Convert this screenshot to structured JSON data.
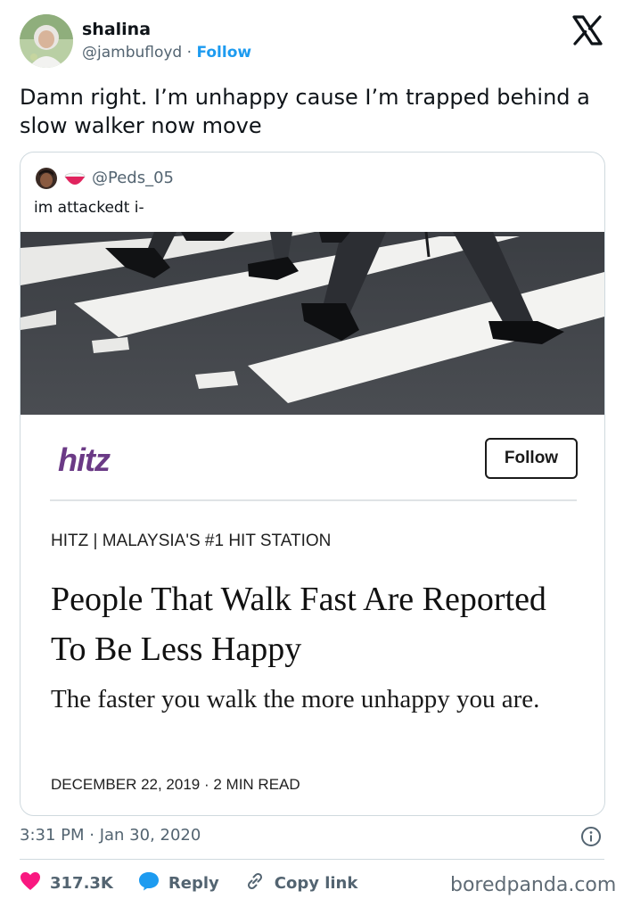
{
  "author": {
    "name": "shalina",
    "handle": "@jambufloyd",
    "separator": "·",
    "follow_label": "Follow"
  },
  "tweet": {
    "text": "Damn right. I’m unhappy cause I’m trapped behind a slow walker now move"
  },
  "quoted": {
    "handle": "@Peds_05",
    "text": "im attackedt i-",
    "article": {
      "brand": "hitz",
      "follow_label": "Follow",
      "kicker": "HITZ | MALAYSIA'S #1 HIT STATION",
      "headline": "People That Walk Fast Are Reported To Be Less Happy",
      "subheadline": "The faster you walk the more unhappy you are.",
      "dateline": "DECEMBER 22, 2019 · 2 MIN READ"
    }
  },
  "meta": {
    "timestamp": "3:31 PM · Jan 30, 2020"
  },
  "actions": {
    "likes": "317.3K",
    "reply_label": "Reply",
    "copy_label": "Copy link"
  },
  "watermark": "boredpanda.com",
  "colors": {
    "like": "#f91880",
    "reply": "#1d9bf0",
    "link": "#1d9bf0",
    "hitz_brand": "#6b3a86"
  },
  "icons": {
    "brand": "x-logo-icon",
    "like": "heart-icon",
    "reply": "speech-bubble-icon",
    "copy": "link-icon",
    "info": "info-icon"
  }
}
